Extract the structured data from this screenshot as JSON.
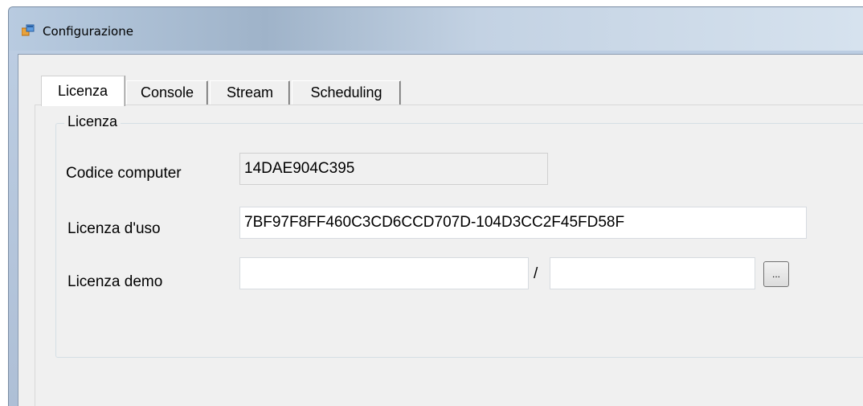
{
  "window": {
    "title": "Configurazione"
  },
  "tabs": [
    "Licenza",
    "Console",
    "Stream",
    "Scheduling"
  ],
  "group": {
    "title": "Licenza"
  },
  "fields": {
    "codice_computer": {
      "label": "Codice computer",
      "value": "14DAE904C395"
    },
    "licenza_uso": {
      "label": "Licenza d'uso",
      "value": "7BF97F8FF460C3CD6CCD707D-104D3CC2F45FD58F"
    },
    "licenza_demo": {
      "label": "Licenza demo",
      "value_1": "",
      "value_2": "",
      "separator": "/"
    }
  },
  "browse_button": {
    "label": "..."
  }
}
